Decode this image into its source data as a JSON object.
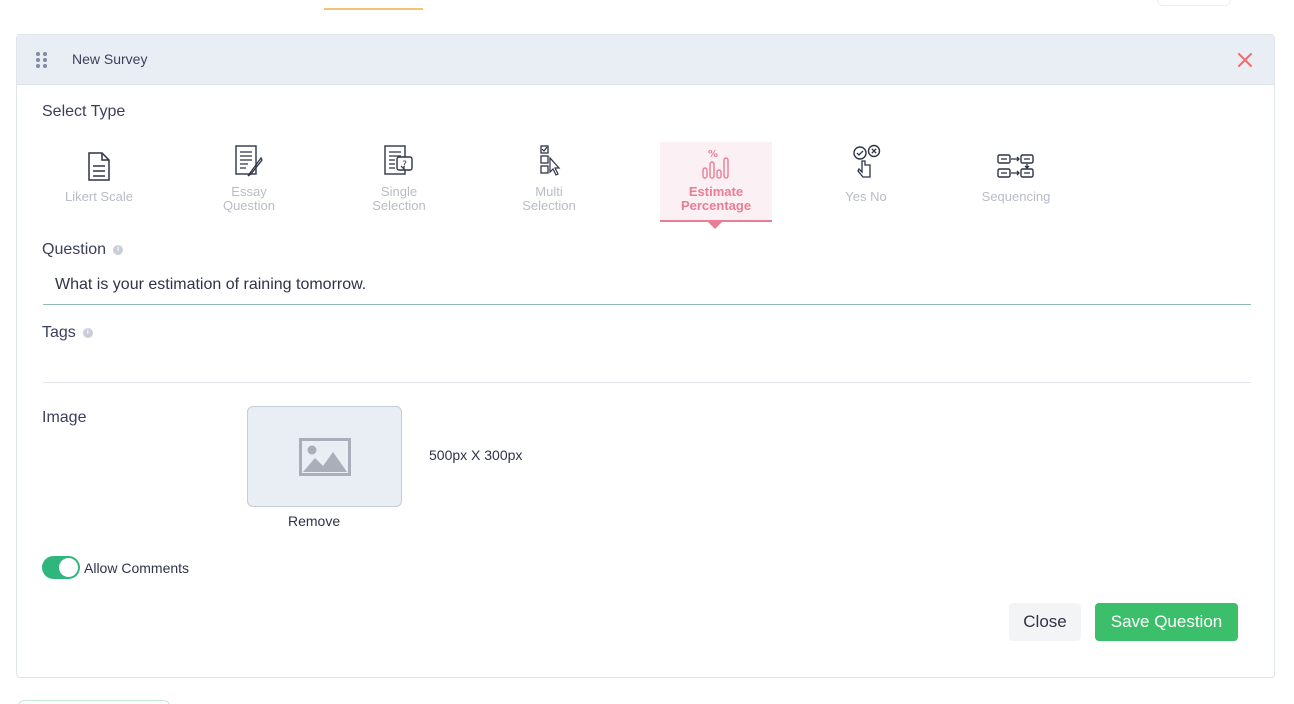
{
  "panel": {
    "title": "New Survey"
  },
  "select_type": {
    "label": "Select Type",
    "items": [
      {
        "line1": "Likert Scale",
        "line2": "",
        "icon": "likert-scale-icon",
        "active": false
      },
      {
        "line1": "Essay",
        "line2": "Question",
        "icon": "essay-question-icon",
        "active": false
      },
      {
        "line1": "Single",
        "line2": "Selection",
        "icon": "single-selection-icon",
        "active": false
      },
      {
        "line1": "Multi",
        "line2": "Selection",
        "icon": "multi-selection-icon",
        "active": false
      },
      {
        "line1": "Estimate",
        "line2": "Percentage",
        "icon": "estimate-percentage-icon",
        "active": true
      },
      {
        "line1": "Yes No",
        "line2": "",
        "icon": "yes-no-icon",
        "active": false
      },
      {
        "line1": "Sequencing",
        "line2": "",
        "icon": "sequencing-icon",
        "active": false
      }
    ]
  },
  "question": {
    "label": "Question",
    "value": "What is your estimation of raining tomorrow."
  },
  "tags": {
    "label": "Tags",
    "value": ""
  },
  "image": {
    "label": "Image",
    "size_hint": "500px X 300px",
    "remove_label": "Remove"
  },
  "comments": {
    "label": "Allow Comments",
    "enabled": true
  },
  "actions": {
    "close_label": "Close",
    "save_label": "Save Question"
  },
  "colors": {
    "accent_active": "#e97d95",
    "toggle_on": "#2eb67d",
    "save_button": "#3bbf6a",
    "close_icon": "#f26b6b",
    "header_bg": "#e9edf4"
  }
}
